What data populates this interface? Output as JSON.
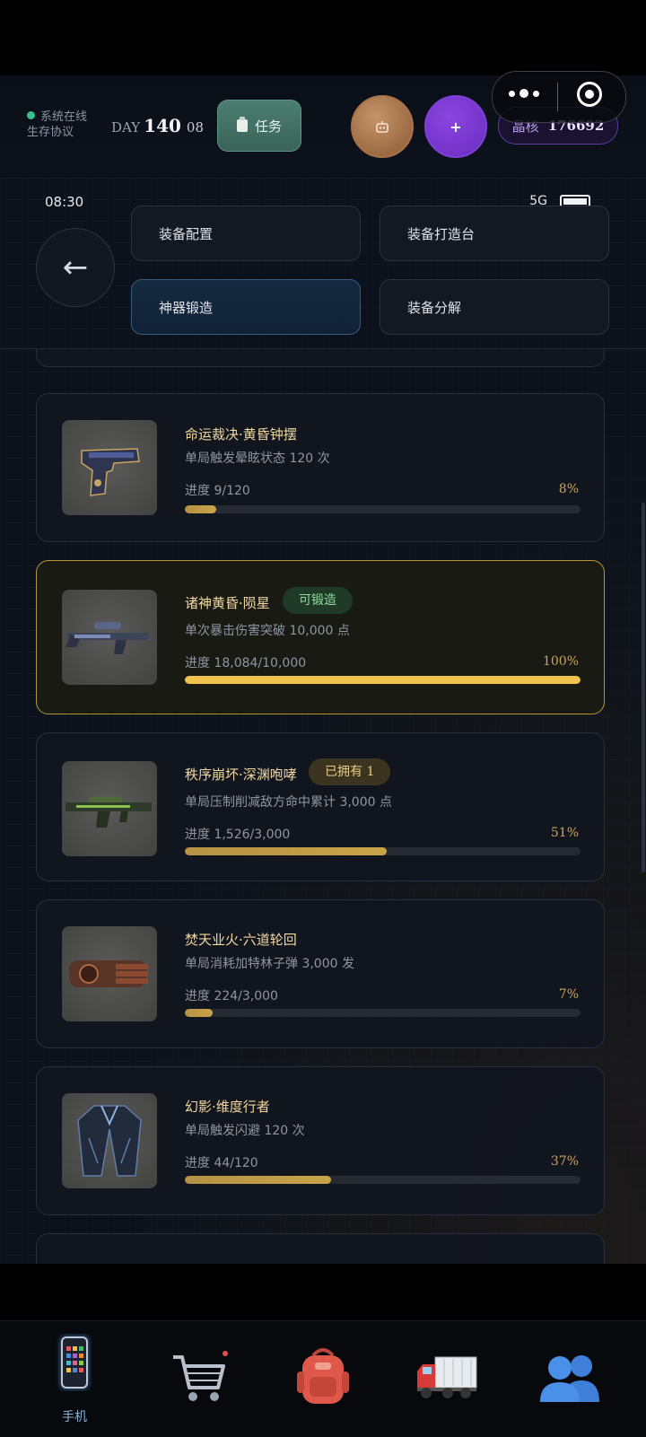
{
  "topbar": {
    "status_text": "系统在线",
    "protocol_text": "生存协议",
    "day_label": "DAY",
    "day_value": "140",
    "day_sub": "08",
    "task_label": "任务",
    "plus_label": "+",
    "crystal_label": "晶核",
    "crystal_value": "176692"
  },
  "status_bar": {
    "time": "08:30",
    "network": "5G"
  },
  "nav": {
    "back_icon": "←",
    "buttons": [
      "装备配置",
      "装备打造台",
      "神器锻造",
      "装备分解"
    ],
    "active": "神器锻造"
  },
  "cards": [
    {
      "title": "命运裁决·黄昏钟摆",
      "desc": "单局触发晕眩状态 120 次",
      "progress": "进度 9/120",
      "percent": "8%",
      "fraction": 0.08,
      "icon": "pistol-icon"
    },
    {
      "title": "诸神黄昏·陨星",
      "badge": "可锻造",
      "desc": "单次暴击伤害突破 10,000 点",
      "progress": "进度 18,084/10,000",
      "percent": "100%",
      "fraction": 1.0,
      "icon": "sniper-rifle-icon",
      "highlight": true
    },
    {
      "title": "秩序崩坏·深渊咆哮",
      "badge": "已拥有 1",
      "desc": "单局压制削减敌方命中累计 3,000 点",
      "progress": "进度 1,526/3,000",
      "percent": "51%",
      "fraction": 0.51,
      "icon": "assault-rifle-icon"
    },
    {
      "title": "焚天业火·六道轮回",
      "desc": "单局消耗加特林子弹 3,000 发",
      "progress": "进度 224/3,000",
      "percent": "7%",
      "fraction": 0.07,
      "icon": "gatling-gun-icon"
    },
    {
      "title": "幻影·维度行者",
      "desc": "单局触发闪避 120 次",
      "progress": "进度 44/120",
      "percent": "37%",
      "fraction": 0.37,
      "icon": "armored-coat-icon"
    }
  ],
  "bottom_nav": {
    "phone_label": "手机",
    "items": [
      "phone-icon",
      "cart-icon",
      "backpack-icon",
      "truck-icon",
      "people-icon"
    ]
  },
  "colors": {
    "gold": "#c9a449",
    "gold_bright": "#f0c34c",
    "purple": "#7d3fd6",
    "bronze": "#a77248",
    "bg": "#0c121b"
  }
}
